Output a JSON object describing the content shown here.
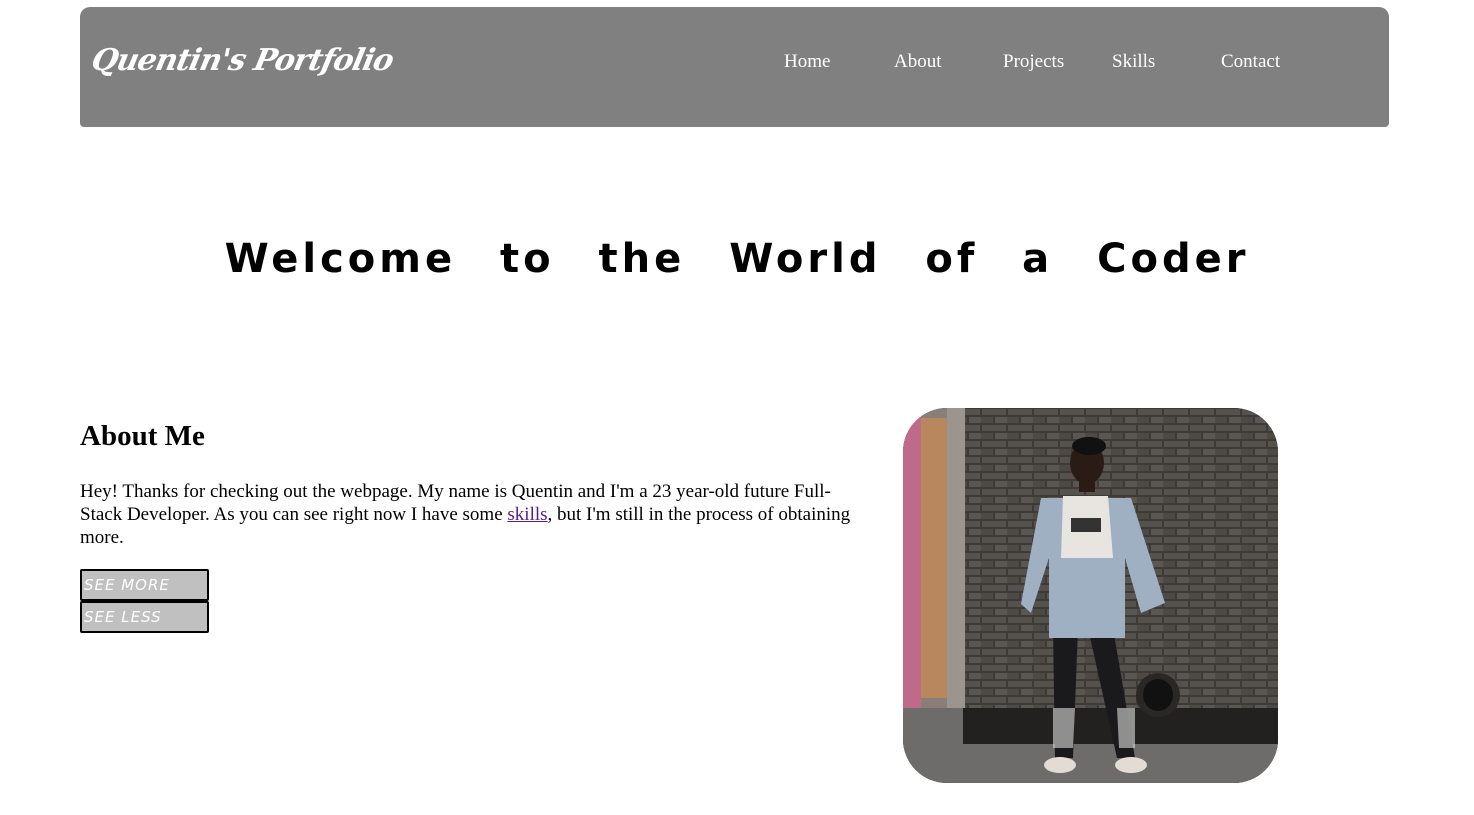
{
  "header": {
    "brand": "Quentin's Portfolio",
    "nav": [
      "Home",
      "About",
      "Projects",
      "Skills",
      "Contact"
    ]
  },
  "hero": {
    "title": "Welcome to the World of a Coder"
  },
  "about": {
    "heading": "About Me",
    "text_before_link": "Hey! Thanks for checking out the webpage. My name is Quentin and I'm a 23 year-old future Full-Stack Developer. As you can see right now I have some ",
    "link_text": "skills",
    "text_after_link": ", but I'm still in the process of obtaining more.",
    "see_more_label": "SEE MORE",
    "see_less_label": "SEE LESS"
  },
  "colors": {
    "header_bg": "#808080",
    "button_bg": "#c0c0c0",
    "link": "#551a8b"
  }
}
